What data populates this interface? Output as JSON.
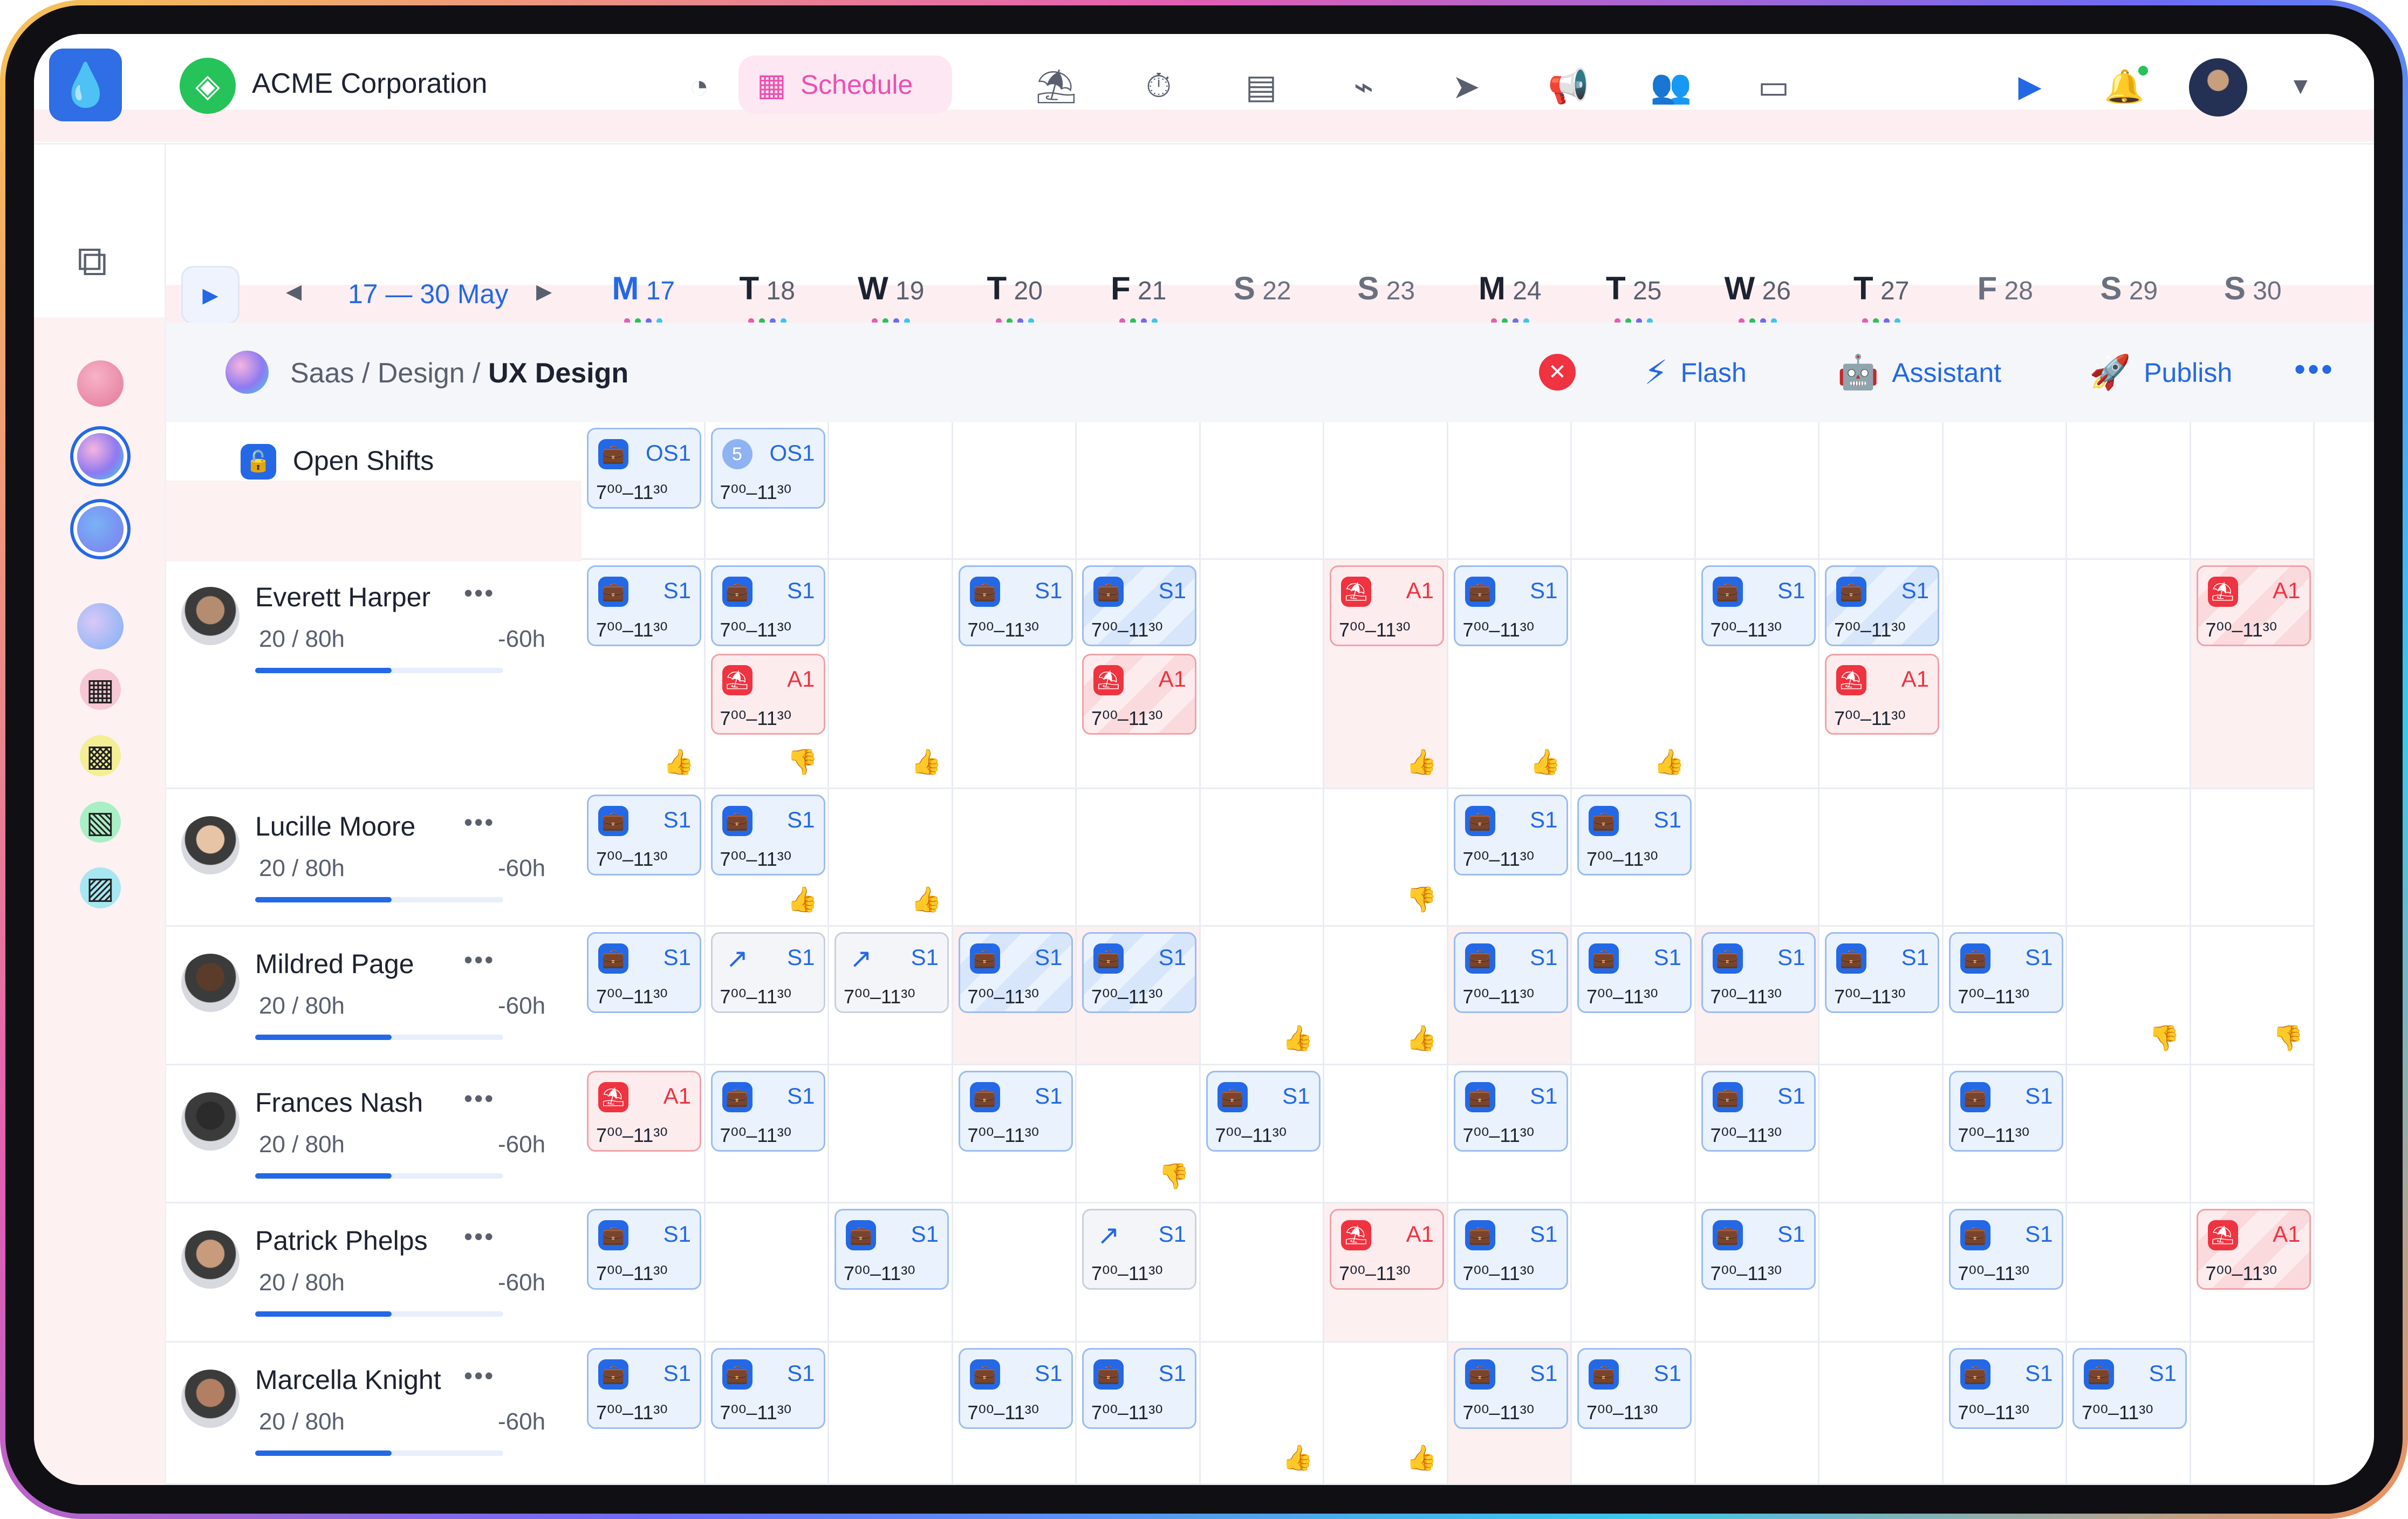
{
  "app": {
    "logo_icon": "drop-icon"
  },
  "org": {
    "name": "ACME Corporation",
    "icon": "globe-icon"
  },
  "nav": {
    "items": [
      {
        "name": "analytics-nav",
        "glyph": "◔"
      },
      {
        "name": "schedule-nav",
        "glyph": "▦",
        "label": "Schedule",
        "active": true
      },
      {
        "name": "vacation-nav",
        "glyph": "⛱"
      },
      {
        "name": "timer-nav",
        "glyph": "⏱"
      },
      {
        "name": "documents-nav",
        "glyph": "▤"
      },
      {
        "name": "reports-nav",
        "glyph": "⌁"
      },
      {
        "name": "send-nav",
        "glyph": "➤"
      },
      {
        "name": "announcements-nav",
        "glyph": "📢"
      },
      {
        "name": "team-nav",
        "glyph": "👥"
      },
      {
        "name": "inbox-nav",
        "glyph": "▭"
      }
    ],
    "schedule_label": "Schedule"
  },
  "header": {
    "range": "17 — 30 May"
  },
  "days": [
    {
      "l": "M",
      "n": "17",
      "sel": true
    },
    {
      "l": "T",
      "n": "18"
    },
    {
      "l": "W",
      "n": "19"
    },
    {
      "l": "T",
      "n": "20"
    },
    {
      "l": "F",
      "n": "21"
    },
    {
      "l": "S",
      "n": "22",
      "wk": true
    },
    {
      "l": "S",
      "n": "23",
      "wk": true
    },
    {
      "l": "M",
      "n": "24"
    },
    {
      "l": "T",
      "n": "25"
    },
    {
      "l": "W",
      "n": "26"
    },
    {
      "l": "T",
      "n": "27"
    },
    {
      "l": "F",
      "n": "28",
      "wk": true
    },
    {
      "l": "S",
      "n": "29",
      "wk": true
    },
    {
      "l": "S",
      "n": "30",
      "wk": true
    }
  ],
  "dot_colors": [
    "#e25fb2",
    "#27c25a",
    "#6c6cf3",
    "#3cc6ee"
  ],
  "breadcrumb": {
    "parts": "Saas / Design / ",
    "current": "UX Design"
  },
  "actions": {
    "flash": "Flash",
    "assistant": "Assistant",
    "publish": "Publish"
  },
  "open_shifts": {
    "label": "Open Shifts"
  },
  "shift_time": "7⁰⁰–11³⁰",
  "employees": [
    {
      "name": "Everett Harper",
      "hours": "20  /  80h",
      "neg": "-60h",
      "progress": 0.55
    },
    {
      "name": "Lucille Moore",
      "hours": "20  /  80h",
      "neg": "-60h",
      "progress": 0.55
    },
    {
      "name": "Mildred Page",
      "hours": "20  /  80h",
      "neg": "-60h",
      "progress": 0.55
    },
    {
      "name": "Frances Nash",
      "hours": "20  /  80h",
      "neg": "-60h",
      "progress": 0.55
    },
    {
      "name": "Patrick Phelps",
      "hours": "20  /  80h",
      "neg": "-60h",
      "progress": 0.55
    },
    {
      "name": "Marcella Knight",
      "hours": "20  /  80h",
      "neg": "-60h",
      "progress": 0.55
    }
  ],
  "open_row": [
    {
      "day": 0,
      "code": "OS1",
      "type": "briefcase"
    },
    {
      "day": 1,
      "code": "OS1",
      "type": "count",
      "count": "5"
    }
  ],
  "rows": [
    {
      "shifts": [
        {
          "day": 0,
          "slot": 0,
          "code": "S1"
        },
        {
          "day": 1,
          "slot": 0,
          "code": "S1"
        },
        {
          "day": 1,
          "slot": 1,
          "code": "A1",
          "red": true
        },
        {
          "day": 3,
          "slot": 0,
          "code": "S1"
        },
        {
          "day": 4,
          "slot": 0,
          "code": "S1",
          "stripe": true
        },
        {
          "day": 4,
          "slot": 1,
          "code": "A1",
          "red": true,
          "stripe": true
        },
        {
          "day": 6,
          "slot": 0,
          "code": "A1",
          "red": true
        },
        {
          "day": 7,
          "slot": 0,
          "code": "S1"
        },
        {
          "day": 9,
          "slot": 0,
          "code": "S1"
        },
        {
          "day": 10,
          "slot": 0,
          "code": "S1",
          "stripe": true
        },
        {
          "day": 10,
          "slot": 1,
          "code": "A1",
          "red": true
        },
        {
          "day": 13,
          "slot": 0,
          "code": "A1",
          "red": true,
          "stripe": true
        }
      ],
      "thumbs": [
        {
          "day": 0,
          "up": true
        },
        {
          "day": 1,
          "up": false
        },
        {
          "day": 2,
          "up": true
        },
        {
          "day": 6,
          "up": true
        },
        {
          "day": 7,
          "up": true
        },
        {
          "day": 8,
          "up": true
        }
      ],
      "pink": [
        6,
        13
      ]
    },
    {
      "shifts": [
        {
          "day": 0,
          "slot": 0,
          "code": "S1"
        },
        {
          "day": 1,
          "slot": 0,
          "code": "S1"
        },
        {
          "day": 7,
          "slot": 0,
          "code": "S1"
        },
        {
          "day": 8,
          "slot": 0,
          "code": "S1"
        }
      ],
      "thumbs": [
        {
          "day": 1,
          "up": true
        },
        {
          "day": 2,
          "up": true
        },
        {
          "day": 6,
          "up": false
        }
      ],
      "pink": []
    },
    {
      "shifts": [
        {
          "day": 0,
          "slot": 0,
          "code": "S1"
        },
        {
          "day": 1,
          "slot": 0,
          "code": "S1",
          "grey": true
        },
        {
          "day": 2,
          "slot": 0,
          "code": "S1",
          "grey": true
        },
        {
          "day": 3,
          "slot": 0,
          "code": "S1",
          "stripe": true
        },
        {
          "day": 4,
          "slot": 0,
          "code": "S1",
          "stripe": true
        },
        {
          "day": 7,
          "slot": 0,
          "code": "S1"
        },
        {
          "day": 8,
          "slot": 0,
          "code": "S1"
        },
        {
          "day": 9,
          "slot": 0,
          "code": "S1"
        },
        {
          "day": 10,
          "slot": 0,
          "code": "S1"
        },
        {
          "day": 11,
          "slot": 0,
          "code": "S1"
        }
      ],
      "thumbs": [
        {
          "day": 5,
          "up": true
        },
        {
          "day": 6,
          "up": true
        },
        {
          "day": 12,
          "up": false
        },
        {
          "day": 13,
          "up": false
        }
      ],
      "pink": [
        3,
        4,
        7,
        9
      ]
    },
    {
      "shifts": [
        {
          "day": 0,
          "slot": 0,
          "code": "A1",
          "red": true
        },
        {
          "day": 1,
          "slot": 0,
          "code": "S1"
        },
        {
          "day": 3,
          "slot": 0,
          "code": "S1"
        },
        {
          "day": 5,
          "slot": 0,
          "code": "S1"
        },
        {
          "day": 7,
          "slot": 0,
          "code": "S1"
        },
        {
          "day": 9,
          "slot": 0,
          "code": "S1"
        },
        {
          "day": 11,
          "slot": 0,
          "code": "S1"
        }
      ],
      "thumbs": [
        {
          "day": 4,
          "up": false
        }
      ],
      "pink": []
    },
    {
      "shifts": [
        {
          "day": 0,
          "slot": 0,
          "code": "S1"
        },
        {
          "day": 2,
          "slot": 0,
          "code": "S1"
        },
        {
          "day": 4,
          "slot": 0,
          "code": "S1",
          "grey": true
        },
        {
          "day": 6,
          "slot": 0,
          "code": "A1",
          "red": true
        },
        {
          "day": 7,
          "slot": 0,
          "code": "S1"
        },
        {
          "day": 9,
          "slot": 0,
          "code": "S1"
        },
        {
          "day": 11,
          "slot": 0,
          "code": "S1"
        },
        {
          "day": 13,
          "slot": 0,
          "code": "A1",
          "red": true,
          "stripe": true
        }
      ],
      "thumbs": [],
      "pink": [
        6
      ]
    },
    {
      "shifts": [
        {
          "day": 0,
          "slot": 0,
          "code": "S1"
        },
        {
          "day": 1,
          "slot": 0,
          "code": "S1"
        },
        {
          "day": 3,
          "slot": 0,
          "code": "S1"
        },
        {
          "day": 4,
          "slot": 0,
          "code": "S1"
        },
        {
          "day": 7,
          "slot": 0,
          "code": "S1"
        },
        {
          "day": 8,
          "slot": 0,
          "code": "S1"
        },
        {
          "day": 11,
          "slot": 0,
          "code": "S1"
        },
        {
          "day": 12,
          "slot": 0,
          "code": "S1"
        }
      ],
      "thumbs": [
        {
          "day": 5,
          "up": true
        },
        {
          "day": 6,
          "up": true
        }
      ],
      "pink": [
        7
      ]
    }
  ]
}
